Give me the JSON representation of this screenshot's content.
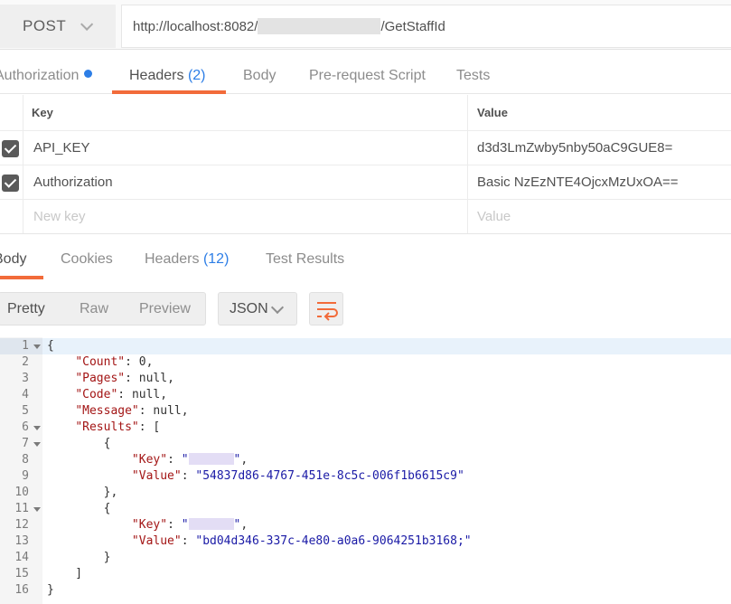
{
  "request": {
    "method": "POST",
    "url_prefix": "http://localhost:8082/",
    "url_suffix": "/GetStaffId"
  },
  "request_tabs": [
    {
      "label": "Authorization"
    },
    {
      "label": "Headers",
      "count": "(2)"
    },
    {
      "label": "Body"
    },
    {
      "label": "Pre-request Script"
    },
    {
      "label": "Tests"
    }
  ],
  "headers_table": {
    "key_header": "Key",
    "value_header": "Value",
    "rows": [
      {
        "key": "API_KEY",
        "value": "d3d3LmZwby5nby50aC9GUE8="
      },
      {
        "key": "Authorization",
        "value": "Basic NzEzNTE4OjcxMzUxOA=="
      }
    ],
    "new_key_placeholder": "New key",
    "new_value_placeholder": "Value"
  },
  "response_tabs": [
    {
      "label": "Body"
    },
    {
      "label": "Cookies"
    },
    {
      "label": "Headers",
      "count": "(12)"
    },
    {
      "label": "Test Results"
    }
  ],
  "view_modes": [
    "Pretty",
    "Raw",
    "Preview"
  ],
  "format": "JSON",
  "icons": {
    "wrap": "wrap-lines-icon",
    "method_dropdown": "chevron-down-icon"
  },
  "colors": {
    "accent": "#f26b3a",
    "count": "#2d7ee6"
  },
  "code": {
    "line_numbers": [
      "1",
      "2",
      "3",
      "4",
      "5",
      "6",
      "7",
      "8",
      "9",
      "10",
      "11",
      "12",
      "13",
      "14",
      "15",
      "16"
    ],
    "keys": {
      "count": "\"Count\"",
      "pages": "\"Pages\"",
      "code": "\"Code\"",
      "message": "\"Message\"",
      "results": "\"Results\"",
      "key": "\"Key\"",
      "value": "\"Value\""
    },
    "values": {
      "count": "0",
      "null": "null"
    },
    "result_values": [
      "\"54837d86-4767-451e-8c5c-006f1b6615c9\"",
      "\"bd04d346-337c-4e80-a0a6-9064251b3168;\""
    ]
  }
}
